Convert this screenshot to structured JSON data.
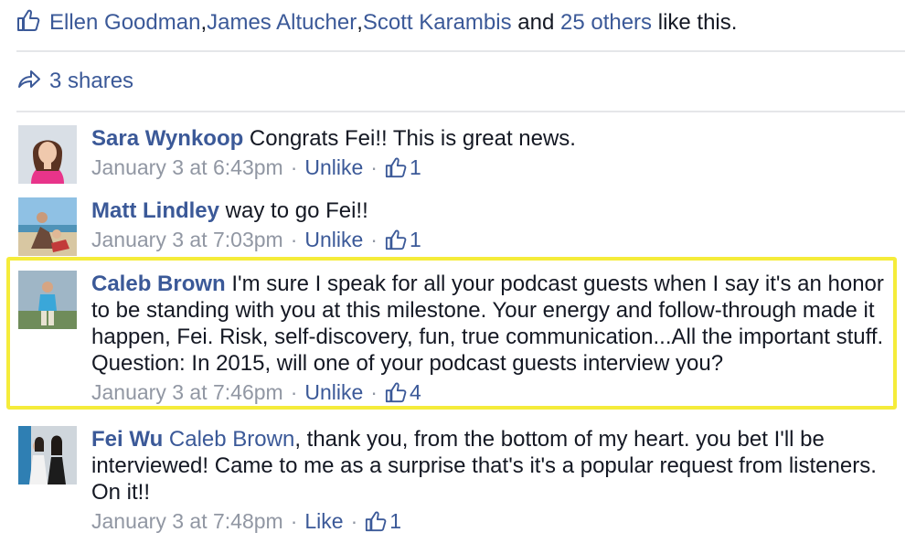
{
  "likes": {
    "names": [
      "Ellen Goodman",
      "James Altucher",
      "Scott Karambis"
    ],
    "sep1": ", ",
    "sep2": ", ",
    "and_text": " and ",
    "others_link": "25 others",
    "suffix": " like this."
  },
  "shares": {
    "label": "3 shares"
  },
  "comments": [
    {
      "author": "Sara Wynkoop",
      "text": " Congrats Fei!! This is great news.",
      "time": "January 3 at 6:43pm",
      "action": "Unlike",
      "likes": "1",
      "avatar_icon": "avatar-photo"
    },
    {
      "author": "Matt Lindley",
      "text": " way to go Fei!!",
      "time": "January 3 at 7:03pm",
      "action": "Unlike",
      "likes": "1",
      "avatar_icon": "avatar-photo"
    },
    {
      "author": "Caleb Brown",
      "text": " I'm sure I speak for all your podcast guests when I say it's an honor to be standing with you at this milestone. Your energy and follow-through made it happen, Fei. Risk, self-discovery, fun, true communication...All the important stuff. Question: In 2015, will one of your podcast guests interview you?",
      "time": "January 3 at 7:46pm",
      "action": "Unlike",
      "likes": "4",
      "avatar_icon": "avatar-photo",
      "highlighted": true
    },
    {
      "author": "Fei Wu",
      "mention": "Caleb Brown",
      "text": ", thank you, from the bottom of my heart. you bet I'll be interviewed! Came to me as a surprise that's it's a popular request from listeners. On it!!",
      "time": "January 3 at 7:48pm",
      "action": "Like",
      "likes": "1",
      "avatar_icon": "avatar-photo"
    }
  ],
  "meta_separator": "·",
  "colors": {
    "link": "#3b5998",
    "text": "#141823",
    "meta": "#9197a3",
    "divider": "#e5e6e9",
    "highlight": "#f5ec3a"
  },
  "icons": {
    "like": "thumbs-up-icon",
    "share": "share-arrow-icon"
  }
}
